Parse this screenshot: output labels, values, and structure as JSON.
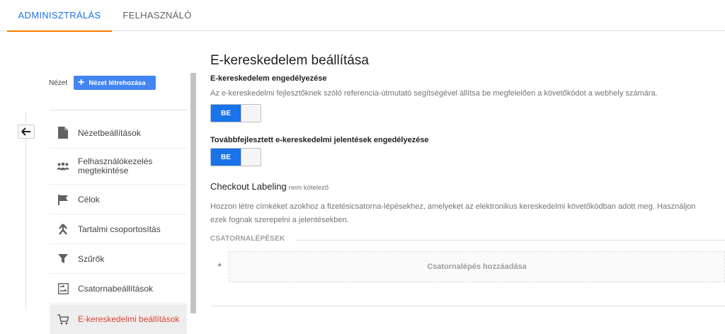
{
  "tabs": {
    "admin": "ADMINISZTRÁLÁS",
    "user": "FELHASZNÁLÓ"
  },
  "sidebar": {
    "view_label": "Nézet",
    "create_view_button": "Nézet létrehozása",
    "items": [
      {
        "label": "Nézetbeállítások",
        "icon": "document-icon"
      },
      {
        "label": "Felhasználókezelés megtekintése",
        "icon": "people-icon"
      },
      {
        "label": "Célok",
        "icon": "flag-icon"
      },
      {
        "label": "Tartalmi csoportosítás",
        "icon": "grouping-icon"
      },
      {
        "label": "Szűrők",
        "icon": "filter-icon"
      },
      {
        "label": "Csatornabeállítások",
        "icon": "channel-icon"
      },
      {
        "label": "E-kereskedelmi beállítások",
        "icon": "cart-icon",
        "active": true
      }
    ]
  },
  "main": {
    "title": "E-kereskedelem beállítása",
    "ecommerce": {
      "heading": "E-kereskedelem engedélyezése",
      "description": "Az e-kereskedelmi fejlesztőknek szóló referencia-útmutató segítségével állítsa be megfelelően a követőkódot a webhely számára.",
      "toggle_label": "BE"
    },
    "enhanced": {
      "heading": "Továbbfejlesztett e-kereskedelmi jelentések engedélyezése",
      "toggle_label": "BE"
    },
    "checkout": {
      "title": "Checkout Labeling",
      "optional": "nem kötelező",
      "description_line1": "Hozzon létre címkéket azokhoz a fizetésicsatorna-lépésekhez, amelyeket az elektronikus kereskedelmi követőkódban adott meg. Használjon",
      "description_line2": "ezek fognak szerepelni a jelentésekben.",
      "steps_header": "CSATORNALÉPÉSEK",
      "plus": "+",
      "add_step": "Csatornalépés hozzáadása"
    }
  },
  "colors": {
    "accent_blue": "#1a73e8",
    "tab_underline": "#f57c00",
    "active_red": "#db4437"
  }
}
